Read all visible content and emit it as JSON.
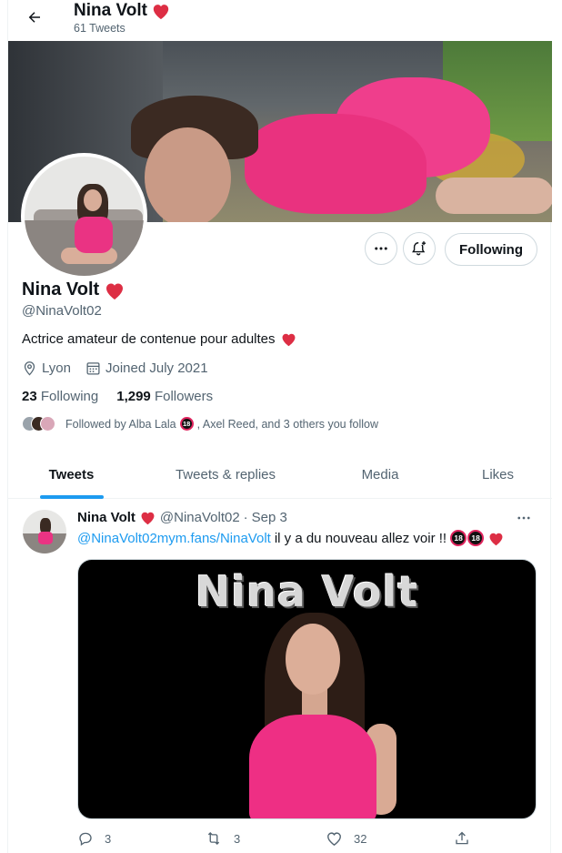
{
  "header": {
    "name": "Nina Volt",
    "tweet_count": "61 Tweets"
  },
  "profile": {
    "name": "Nina Volt",
    "handle": "@NinaVolt02",
    "bio": "Actrice amateur de contenue pour adultes",
    "location": "Lyon",
    "joined": "Joined July 2021",
    "following_count": "23",
    "following_label": "Following",
    "followers_count": "1,299",
    "followers_label": "Followers",
    "followed_by": "Followed by Alba Lala",
    "followed_by_rest": ", Axel Reed, and 3 others you follow",
    "follow_button": "Following"
  },
  "tabs": [
    {
      "label": "Tweets",
      "active": true
    },
    {
      "label": "Tweets & replies",
      "active": false
    },
    {
      "label": "Media",
      "active": false
    },
    {
      "label": "Likes",
      "active": false
    }
  ],
  "tweet": {
    "name": "Nina Volt",
    "handle": "@NinaVolt02",
    "sep": "·",
    "date": "Sep 3",
    "mention": "@NinaVolt02",
    "link": "mym.fans/NinaVolt",
    "text": "il y a du nouveau allez voir !!",
    "media_title": "Nina Volt",
    "replies": "3",
    "retweets": "3",
    "likes": "32"
  },
  "badge_18": "18",
  "colors": {
    "accent": "#1d9bf0",
    "heart": "#e0245e",
    "text": "#0f1419",
    "muted": "#536471"
  },
  "icons": [
    "back-arrow-icon",
    "heart-icon",
    "more-icon",
    "bell-plus-icon",
    "location-icon",
    "calendar-icon",
    "reply-icon",
    "retweet-icon",
    "like-icon",
    "share-icon"
  ]
}
